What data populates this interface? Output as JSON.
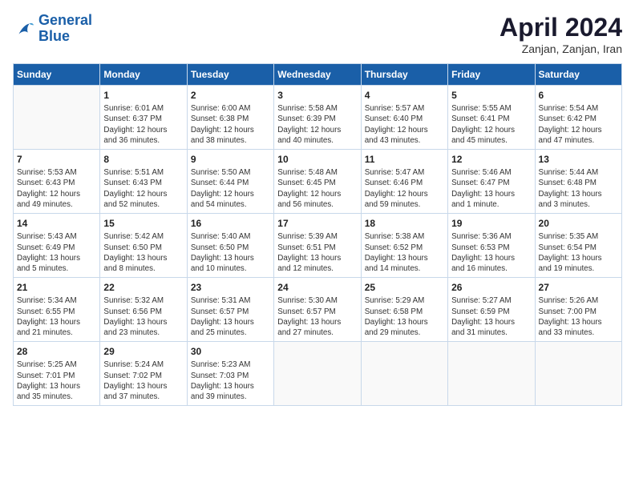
{
  "logo": {
    "line1": "General",
    "line2": "Blue"
  },
  "title": "April 2024",
  "subtitle": "Zanjan, Zanjan, Iran",
  "headers": [
    "Sunday",
    "Monday",
    "Tuesday",
    "Wednesday",
    "Thursday",
    "Friday",
    "Saturday"
  ],
  "weeks": [
    [
      {
        "num": "",
        "info": ""
      },
      {
        "num": "1",
        "info": "Sunrise: 6:01 AM\nSunset: 6:37 PM\nDaylight: 12 hours\nand 36 minutes."
      },
      {
        "num": "2",
        "info": "Sunrise: 6:00 AM\nSunset: 6:38 PM\nDaylight: 12 hours\nand 38 minutes."
      },
      {
        "num": "3",
        "info": "Sunrise: 5:58 AM\nSunset: 6:39 PM\nDaylight: 12 hours\nand 40 minutes."
      },
      {
        "num": "4",
        "info": "Sunrise: 5:57 AM\nSunset: 6:40 PM\nDaylight: 12 hours\nand 43 minutes."
      },
      {
        "num": "5",
        "info": "Sunrise: 5:55 AM\nSunset: 6:41 PM\nDaylight: 12 hours\nand 45 minutes."
      },
      {
        "num": "6",
        "info": "Sunrise: 5:54 AM\nSunset: 6:42 PM\nDaylight: 12 hours\nand 47 minutes."
      }
    ],
    [
      {
        "num": "7",
        "info": "Sunrise: 5:53 AM\nSunset: 6:43 PM\nDaylight: 12 hours\nand 49 minutes."
      },
      {
        "num": "8",
        "info": "Sunrise: 5:51 AM\nSunset: 6:43 PM\nDaylight: 12 hours\nand 52 minutes."
      },
      {
        "num": "9",
        "info": "Sunrise: 5:50 AM\nSunset: 6:44 PM\nDaylight: 12 hours\nand 54 minutes."
      },
      {
        "num": "10",
        "info": "Sunrise: 5:48 AM\nSunset: 6:45 PM\nDaylight: 12 hours\nand 56 minutes."
      },
      {
        "num": "11",
        "info": "Sunrise: 5:47 AM\nSunset: 6:46 PM\nDaylight: 12 hours\nand 59 minutes."
      },
      {
        "num": "12",
        "info": "Sunrise: 5:46 AM\nSunset: 6:47 PM\nDaylight: 13 hours\nand 1 minute."
      },
      {
        "num": "13",
        "info": "Sunrise: 5:44 AM\nSunset: 6:48 PM\nDaylight: 13 hours\nand 3 minutes."
      }
    ],
    [
      {
        "num": "14",
        "info": "Sunrise: 5:43 AM\nSunset: 6:49 PM\nDaylight: 13 hours\nand 5 minutes."
      },
      {
        "num": "15",
        "info": "Sunrise: 5:42 AM\nSunset: 6:50 PM\nDaylight: 13 hours\nand 8 minutes."
      },
      {
        "num": "16",
        "info": "Sunrise: 5:40 AM\nSunset: 6:50 PM\nDaylight: 13 hours\nand 10 minutes."
      },
      {
        "num": "17",
        "info": "Sunrise: 5:39 AM\nSunset: 6:51 PM\nDaylight: 13 hours\nand 12 minutes."
      },
      {
        "num": "18",
        "info": "Sunrise: 5:38 AM\nSunset: 6:52 PM\nDaylight: 13 hours\nand 14 minutes."
      },
      {
        "num": "19",
        "info": "Sunrise: 5:36 AM\nSunset: 6:53 PM\nDaylight: 13 hours\nand 16 minutes."
      },
      {
        "num": "20",
        "info": "Sunrise: 5:35 AM\nSunset: 6:54 PM\nDaylight: 13 hours\nand 19 minutes."
      }
    ],
    [
      {
        "num": "21",
        "info": "Sunrise: 5:34 AM\nSunset: 6:55 PM\nDaylight: 13 hours\nand 21 minutes."
      },
      {
        "num": "22",
        "info": "Sunrise: 5:32 AM\nSunset: 6:56 PM\nDaylight: 13 hours\nand 23 minutes."
      },
      {
        "num": "23",
        "info": "Sunrise: 5:31 AM\nSunset: 6:57 PM\nDaylight: 13 hours\nand 25 minutes."
      },
      {
        "num": "24",
        "info": "Sunrise: 5:30 AM\nSunset: 6:57 PM\nDaylight: 13 hours\nand 27 minutes."
      },
      {
        "num": "25",
        "info": "Sunrise: 5:29 AM\nSunset: 6:58 PM\nDaylight: 13 hours\nand 29 minutes."
      },
      {
        "num": "26",
        "info": "Sunrise: 5:27 AM\nSunset: 6:59 PM\nDaylight: 13 hours\nand 31 minutes."
      },
      {
        "num": "27",
        "info": "Sunrise: 5:26 AM\nSunset: 7:00 PM\nDaylight: 13 hours\nand 33 minutes."
      }
    ],
    [
      {
        "num": "28",
        "info": "Sunrise: 5:25 AM\nSunset: 7:01 PM\nDaylight: 13 hours\nand 35 minutes."
      },
      {
        "num": "29",
        "info": "Sunrise: 5:24 AM\nSunset: 7:02 PM\nDaylight: 13 hours\nand 37 minutes."
      },
      {
        "num": "30",
        "info": "Sunrise: 5:23 AM\nSunset: 7:03 PM\nDaylight: 13 hours\nand 39 minutes."
      },
      {
        "num": "",
        "info": ""
      },
      {
        "num": "",
        "info": ""
      },
      {
        "num": "",
        "info": ""
      },
      {
        "num": "",
        "info": ""
      }
    ]
  ]
}
